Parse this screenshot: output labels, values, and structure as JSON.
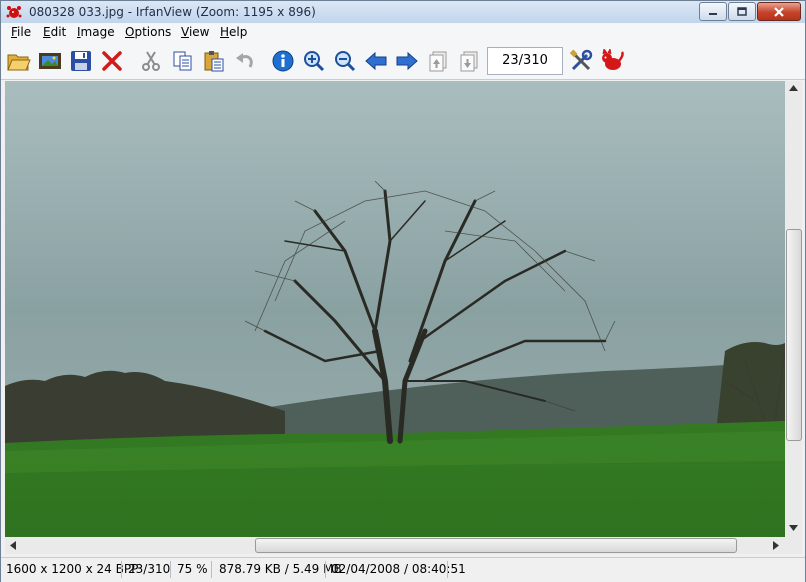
{
  "window": {
    "title": "080328 033.jpg - IrfanView (Zoom: 1195 x 896)"
  },
  "menu": {
    "items": [
      {
        "key": "F",
        "rest": "ile"
      },
      {
        "key": "E",
        "rest": "dit"
      },
      {
        "key": "I",
        "rest": "mage"
      },
      {
        "key": "O",
        "rest": "ptions"
      },
      {
        "key": "V",
        "rest": "iew"
      },
      {
        "key": "H",
        "rest": "elp"
      }
    ]
  },
  "toolbar": {
    "icons": [
      "open-folder-icon",
      "slideshow-icon",
      "save-icon",
      "delete-icon",
      "cut-icon",
      "copy-icon",
      "paste-icon",
      "undo-icon",
      "info-icon",
      "zoom-in-icon",
      "zoom-out-icon",
      "previous-arrow-icon",
      "next-arrow-icon",
      "first-page-icon",
      "last-page-icon",
      "settings-tools-icon",
      "irfanview-cat-icon"
    ],
    "counter": "23/310"
  },
  "status": {
    "dimensions": "1600 x 1200 x 24 BPP",
    "position": "23/310",
    "zoom": "75 %",
    "filesize": "878.79 KB / 5.49 MB",
    "datetime": "02/04/2008 / 08:40:51"
  },
  "colors": {
    "sky": "#9fb3b3",
    "grass": "#3f8a2a",
    "treeline": "#2e3a34",
    "close_button": "#c5432a"
  }
}
